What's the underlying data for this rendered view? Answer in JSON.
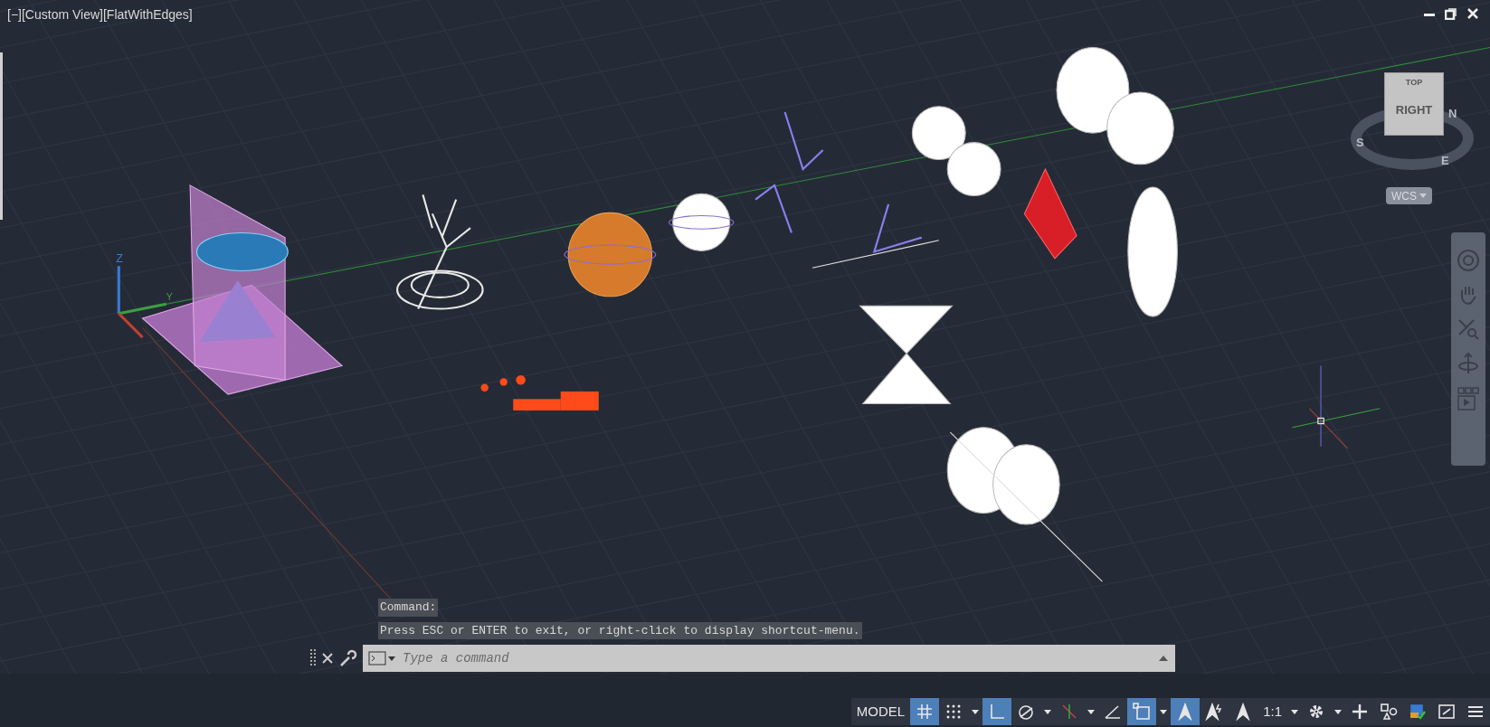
{
  "viewport": {
    "label": "[−][Custom View][FlatWithEdges]",
    "ucs_labels": [
      "Z",
      "Y"
    ]
  },
  "view_cube": {
    "faces": [
      "TOP",
      "RIGHT"
    ],
    "compass": [
      "N",
      "S",
      "E"
    ],
    "ucs_menu": "WCS"
  },
  "command_line": {
    "history": [
      "Command:",
      "Press ESC or ENTER to exit, or right-click to display shortcut-menu."
    ],
    "placeholder": "Type a command"
  },
  "status_bar": {
    "items": [
      {
        "kind": "text",
        "label": "MODEL",
        "selected": false
      },
      {
        "kind": "grid",
        "selected": true
      },
      {
        "kind": "snap",
        "selected": false
      },
      {
        "kind": "caret",
        "selected": false
      },
      {
        "kind": "ortho",
        "selected": true
      },
      {
        "kind": "polar",
        "selected": false
      },
      {
        "kind": "caret",
        "selected": false
      },
      {
        "kind": "isodraft",
        "selected": false
      },
      {
        "kind": "caret",
        "selected": false
      },
      {
        "kind": "angle",
        "selected": false
      },
      {
        "kind": "square",
        "selected": true
      },
      {
        "kind": "caret",
        "selected": false
      },
      {
        "kind": "annotate",
        "selected": true
      },
      {
        "kind": "annotate2",
        "selected": false
      },
      {
        "kind": "annotate3",
        "selected": false
      },
      {
        "kind": "text",
        "label": "1:1",
        "selected": false
      },
      {
        "kind": "caret",
        "selected": false
      },
      {
        "kind": "gear",
        "selected": false
      },
      {
        "kind": "caret",
        "selected": false
      },
      {
        "kind": "plus",
        "selected": false
      },
      {
        "kind": "shapes",
        "selected": false
      },
      {
        "kind": "accel",
        "selected": false
      },
      {
        "kind": "fullscreen",
        "selected": false
      },
      {
        "kind": "menu",
        "selected": false
      }
    ]
  }
}
